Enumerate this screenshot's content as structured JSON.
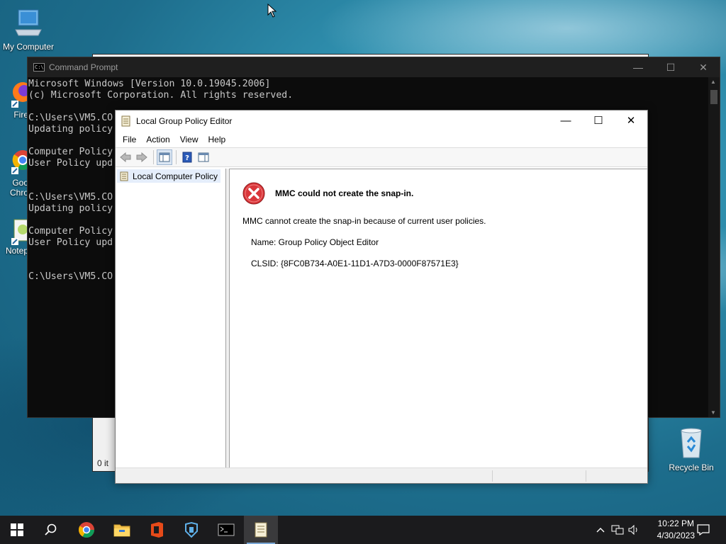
{
  "desktop": {
    "icons": [
      {
        "label": "My Computer"
      },
      {
        "label": "Fire"
      },
      {
        "label": "Goo Chro"
      },
      {
        "label": "Notep"
      },
      {
        "label": "Recycle Bin"
      }
    ]
  },
  "explorer_bg": {
    "status": "0 it"
  },
  "cmd": {
    "title": "Command Prompt",
    "lines": [
      "Microsoft Windows [Version 10.0.19045.2006]",
      "(c) Microsoft Corporation. All rights reserved.",
      "",
      "C:\\Users\\VM5.CO",
      "Updating policy",
      "",
      "Computer Policy",
      "User Policy upd",
      "",
      "",
      "C:\\Users\\VM5.CO",
      "Updating policy",
      "",
      "Computer Policy",
      "User Policy upd",
      "",
      "",
      "C:\\Users\\VM5.CO"
    ]
  },
  "gpe": {
    "title": "Local Group Policy Editor",
    "menu": [
      "File",
      "Action",
      "View",
      "Help"
    ],
    "tree_item": "Local Computer Policy",
    "error_title": "MMC could not create the snap-in.",
    "message": "MMC cannot create the snap-in because of current user policies.",
    "name_line": "Name: Group Policy Object Editor",
    "clsid_line": "CLSID: {8FC0B734-A0E1-11D1-A7D3-0000F87571E3}"
  },
  "taskbar": {
    "time": "10:22 PM",
    "date": "4/30/2023"
  },
  "colors": {
    "error_red": "#d9363a",
    "taskbar": "#1b1b1d",
    "selection": "#e5eefb"
  }
}
